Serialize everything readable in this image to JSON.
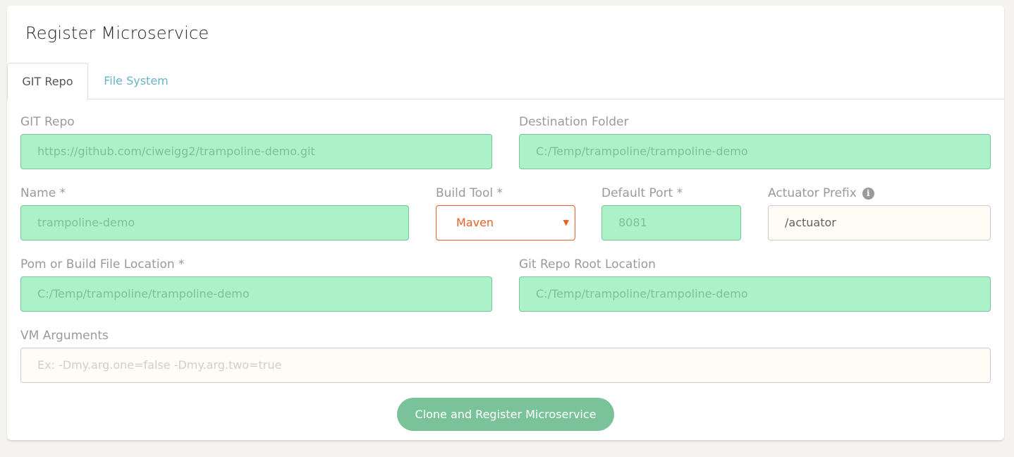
{
  "title": "Register Microservice",
  "tabs": [
    {
      "label": "GIT Repo",
      "active": true
    },
    {
      "label": "File System",
      "active": false
    }
  ],
  "form": {
    "git_repo": {
      "label": "GIT Repo",
      "value": "https://github.com/ciweigg2/trampoline-demo.git"
    },
    "destination_folder": {
      "label": "Destination Folder",
      "value": "C:/Temp/trampoline/trampoline-demo"
    },
    "name": {
      "label": "Name *",
      "value": "trampoline-demo"
    },
    "build_tool": {
      "label": "Build Tool *",
      "value": "Maven"
    },
    "default_port": {
      "label": "Default Port *",
      "value": "8081"
    },
    "actuator_prefix": {
      "label": "Actuator Prefix",
      "value": "/actuator",
      "info_icon": "i"
    },
    "pom_location": {
      "label": "Pom or Build File Location *",
      "value": "C:/Temp/trampoline/trampoline-demo"
    },
    "git_root_location": {
      "label": "Git Repo Root Location",
      "value": "C:/Temp/trampoline/trampoline-demo"
    },
    "vm_arguments": {
      "label": "VM Arguments",
      "value": "",
      "placeholder": "Ex: -Dmy.arg.one=false -Dmy.arg.two=true"
    }
  },
  "submit_label": "Clone and Register Microservice",
  "colors": {
    "success": "#7ac29a",
    "success_bg": "#abf2c8",
    "danger": "#eb5e28",
    "info": "#68b3c8"
  }
}
